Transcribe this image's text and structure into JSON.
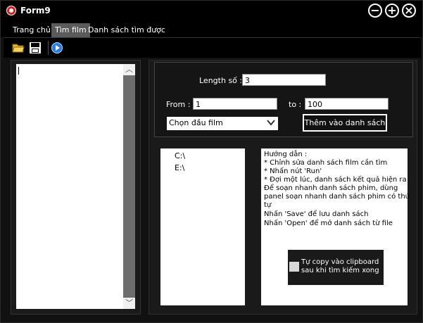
{
  "window": {
    "title": "Form9"
  },
  "window_controls": {
    "minimize": "−",
    "maximize": "+",
    "close": "×"
  },
  "tabs": [
    {
      "label": "Trang chủ"
    },
    {
      "label": "Tìm film",
      "active": true
    },
    {
      "label": "Danh sách tìm được"
    }
  ],
  "toolbar": {
    "open_icon": "folder-open-icon",
    "save_icon": "floppy-disk-icon",
    "run_icon": "play-icon"
  },
  "form": {
    "length_label": "Length số :",
    "length_value": "3",
    "from_label": "From :",
    "from_value": "1",
    "to_label": "to :",
    "to_value": "100",
    "prefix_select": "Chọn đầu film",
    "add_button": "Thêm vào danh sách"
  },
  "drives": [
    "C:\\",
    "E:\\"
  ],
  "help_lines": [
    "Hướng dẫn :",
    "* Chỉnh sửa danh sách film cần tìm",
    "* Nhấn nút 'Run'",
    "* Đợi một lúc, danh sách kết quả hiện ra",
    "Để soạn nhanh danh sách phim, dùng",
    "panel soạn nhanh danh sách phim có thứ",
    "tự",
    "Nhấn 'Save' để lưu danh sách",
    "Nhấn 'Open' để mở danh sách từ file"
  ],
  "clipboard_option": {
    "label": "Tự copy vào clipboard\nsau khi tìm kiếm xong",
    "checked": false
  },
  "colors": {
    "background": "#111111",
    "active_tab": "#5a5a5a",
    "app_icon": "#d42020"
  }
}
